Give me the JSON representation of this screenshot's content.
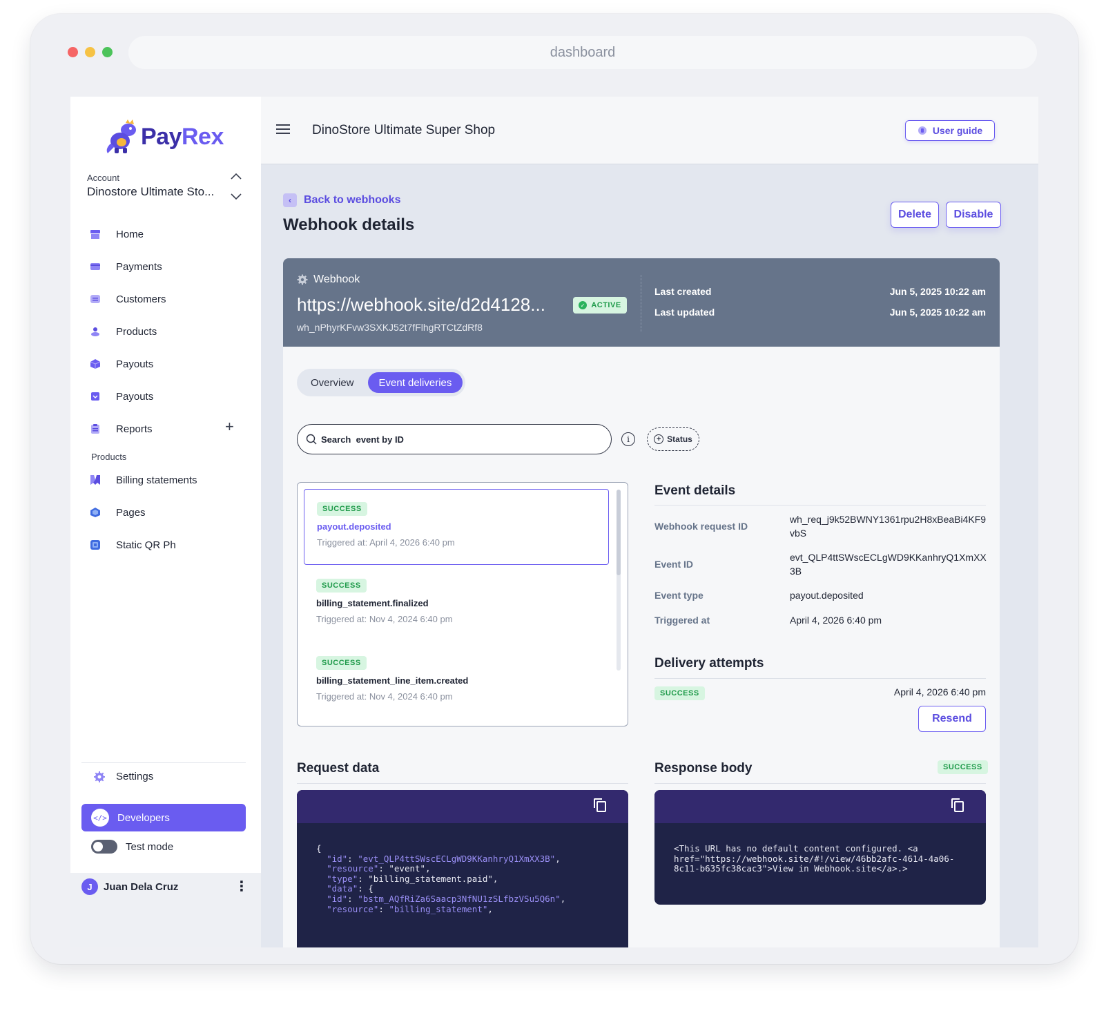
{
  "browser": {
    "url": "dashboard"
  },
  "brand": {
    "name_a": "Pay",
    "name_b": "Rex",
    "accent": "#6a5cf0",
    "dark": "#3b2fa8"
  },
  "account": {
    "label": "Account",
    "name": "Dinostore Ultimate Sto..."
  },
  "sidebar": {
    "items": [
      {
        "label": "Home",
        "icon": "store-icon"
      },
      {
        "label": "Payments",
        "icon": "card-icon"
      },
      {
        "label": "Customers",
        "icon": "customers-icon"
      },
      {
        "label": "Products",
        "icon": "products-icon"
      },
      {
        "label": "Payouts",
        "icon": "cube-icon"
      },
      {
        "label": "Payouts",
        "icon": "payout-box-icon"
      },
      {
        "label": "Reports",
        "icon": "clipboard-icon"
      }
    ],
    "products_label": "Products",
    "product_items": [
      {
        "label": "Billing statements",
        "icon": "billing-icon"
      },
      {
        "label": "Pages",
        "icon": "pages-icon"
      },
      {
        "label": "Static QR Ph",
        "icon": "qr-icon"
      }
    ],
    "settings": "Settings",
    "developers": "Developers",
    "test_mode": "Test mode",
    "user": {
      "initial": "J",
      "name": "Juan Dela Cruz"
    }
  },
  "topbar": {
    "shop": "DinoStore Ultimate Super Shop",
    "user_guide": "User guide"
  },
  "page": {
    "back": "Back to webhooks",
    "title": "Webhook details",
    "delete": "Delete",
    "disable": "Disable"
  },
  "webhook": {
    "label": "Webhook",
    "url": "https://webhook.site/d2d4128...",
    "status": "ACTIVE",
    "id": "wh_nPhyrKFvw3SXKJ52t7fFlhgRTCtZdRf8",
    "last_created_label": "Last created",
    "last_created": "Jun 5, 2025 10:22 am",
    "last_updated_label": "Last updated",
    "last_updated": "Jun 5, 2025 10:22 am"
  },
  "tabs": [
    "Overview",
    "Event deliveries"
  ],
  "search": {
    "placeholder": "Search  event by ID"
  },
  "status_filter": "Status",
  "events": [
    {
      "status": "SUCCESS",
      "type": "payout.deposited",
      "time": "Triggered at: April 4, 2026 6:40 pm"
    },
    {
      "status": "SUCCESS",
      "type": "billing_statement.finalized",
      "time": "Triggered at: Nov 4, 2024 6:40 pm"
    },
    {
      "status": "SUCCESS",
      "type": "billing_statement_line_item.created",
      "time": "Triggered at: Nov 4, 2024 6:40 pm"
    }
  ],
  "event_details": {
    "title": "Event details",
    "request_id_label": "Webhook request ID",
    "request_id": "wh_req_j9k52BWNY1361rpu2H8xBeaBi4KF9vbS",
    "event_id_label": "Event ID",
    "event_id": "evt_QLP4ttSWscECLgWD9KKanhryQ1XmXX3B",
    "event_type_label": "Event type",
    "event_type": "payout.deposited",
    "triggered_label": "Triggered at",
    "triggered": "April 4, 2026 6:40 pm"
  },
  "delivery": {
    "title": "Delivery attempts",
    "status": "SUCCESS",
    "time": "April 4, 2026 6:40 pm",
    "resend": "Resend"
  },
  "request_data": {
    "title": "Request data",
    "lines": [
      "{",
      "  \"id\": \"evt_QLP4ttSWscECLgWD9KKanhryQ1XmXX3B\",",
      "  \"resource\": \"event\",",
      "  \"type\": \"billing_statement.paid\",",
      "  \"data\": {",
      "  \"id\": \"bstm_AQfRiZa6Saacp3NfNU1zSLfbzVSu5Q6n\",",
      "  \"resource\": \"billing_statement\","
    ]
  },
  "response_body": {
    "title": "Response body",
    "status": "SUCCESS",
    "text": "<This URL has no default content configured. <a href=\"https://webhook.site/#!/view/46bb2afc-4614-4a06-8c11-b635fc38cac3\">View in Webhook.site</a>.>"
  }
}
